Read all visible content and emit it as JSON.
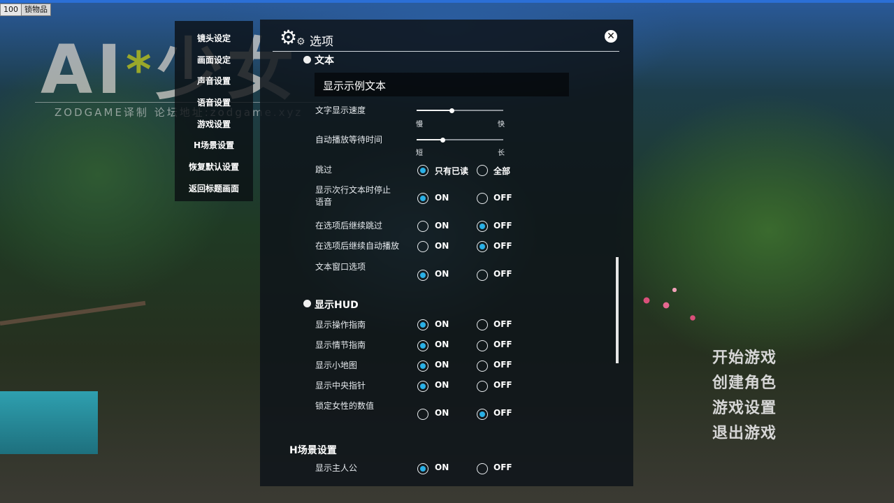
{
  "hud": {
    "fps": "100",
    "lock_button": "锁物品"
  },
  "watermark": {
    "title_a": "AI",
    "title_star": "*",
    "title_b": "少女",
    "subtitle": "ZODGAME译制 论坛地址:zodgame.xyz"
  },
  "sidebar": {
    "items": [
      {
        "label": "镜头设定"
      },
      {
        "label": "画面设定"
      },
      {
        "label": "声音设置"
      },
      {
        "label": "语音设置"
      },
      {
        "label": "游戏设置"
      },
      {
        "label": "H场景设置"
      },
      {
        "label": "恢复默认设置"
      },
      {
        "label": "返回标题画面"
      }
    ]
  },
  "dialog": {
    "title": "选项",
    "text_section": {
      "header": "文本",
      "sample_text": "显示示例文本",
      "text_speed": {
        "label": "文字显示速度",
        "min_label": "慢",
        "max_label": "快",
        "value": 0.4
      },
      "auto_wait": {
        "label": "自动播放等待时间",
        "min_label": "短",
        "max_label": "长",
        "value": 0.3
      },
      "skip": {
        "label": "跳过",
        "option_a": "只有已读",
        "option_b": "全部",
        "selected": "option_a"
      },
      "stop_voice": {
        "label_line1": "显示次行文本时停止",
        "label_line2": "语音",
        "on": "ON",
        "off": "OFF",
        "selected": "on"
      },
      "skip_after_choice": {
        "label": "在选项后继续跳过",
        "on": "ON",
        "off": "OFF",
        "selected": "off"
      },
      "auto_after_choice": {
        "label": "在选项后继续自动播放",
        "on": "ON",
        "off": "OFF",
        "selected": "off"
      },
      "text_window": {
        "label": "文本窗口选项",
        "on": "ON",
        "off": "OFF",
        "selected": "on"
      }
    },
    "hud_section": {
      "header": "显示HUD",
      "operation_guide": {
        "label": "显示操作指南",
        "on": "ON",
        "off": "OFF",
        "selected": "on"
      },
      "story_guide": {
        "label": "显示情节指南",
        "on": "ON",
        "off": "OFF",
        "selected": "on"
      },
      "minimap": {
        "label": "显示小地图",
        "on": "ON",
        "off": "OFF",
        "selected": "on"
      },
      "compass": {
        "label": "显示中央指针",
        "on": "ON",
        "off": "OFF",
        "selected": "on"
      },
      "lock_female_stats": {
        "label": "锁定女性的数值",
        "on": "ON",
        "off": "OFF",
        "selected": "off"
      }
    },
    "h_section": {
      "header": "H场景设置",
      "show_protagonist": {
        "label": "显示主人公",
        "on": "ON",
        "off": "OFF",
        "selected": "on"
      }
    }
  },
  "title_menu": {
    "start": "开始游戏",
    "create": "创建角色",
    "settings": "游戏设置",
    "quit": "退出游戏"
  },
  "colors": {
    "accent": "#2ab0e6",
    "panel_bg": "#0e141a"
  }
}
